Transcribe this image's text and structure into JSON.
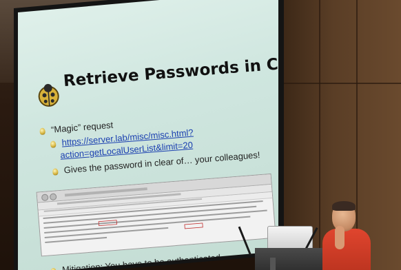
{
  "slide": {
    "title": "Retrieve Passwords in Clear",
    "bullet_1": "“Magic” request",
    "link_line_1": "https://server.lab/misc/misc.html?",
    "link_line_2": "action=getLocalUserList&limit=20",
    "bullet_2": "Gives the password in clear of… your colleagues!",
    "bullet_3": "Mitigation: You have to be authenticated"
  }
}
